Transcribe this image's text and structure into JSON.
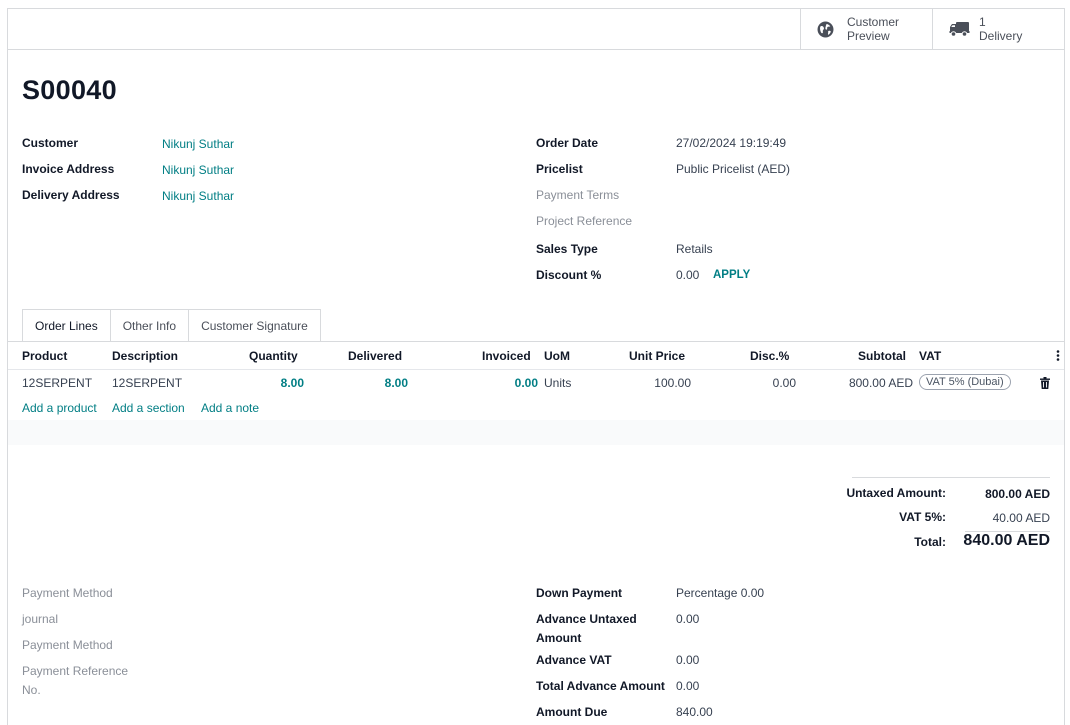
{
  "smart_buttons": {
    "preview": {
      "line1": "Customer",
      "line2": "Preview",
      "icon": "globe-icon"
    },
    "delivery": {
      "count": "1",
      "label": "Delivery",
      "icon": "truck-icon"
    }
  },
  "record": {
    "name": "S00040"
  },
  "left_fields": {
    "customer": {
      "label": "Customer",
      "value": "Nikunj Suthar"
    },
    "invoice_address": {
      "label": "Invoice Address",
      "value": "Nikunj Suthar"
    },
    "delivery_address": {
      "label": "Delivery Address",
      "value": "Nikunj Suthar"
    }
  },
  "right_fields": {
    "order_date": {
      "label": "Order Date",
      "value": "27/02/2024 19:19:49"
    },
    "pricelist": {
      "label": "Pricelist",
      "value": "Public Pricelist (AED)"
    },
    "payment_terms": {
      "label": "Payment Terms",
      "value": ""
    },
    "project_reference": {
      "label": "Project Reference",
      "value": ""
    },
    "sales_type": {
      "label": "Sales Type",
      "value": "Retails"
    },
    "discount": {
      "label": "Discount %",
      "value": "0.00",
      "apply": "APPLY"
    }
  },
  "tabs": [
    {
      "label": "Order Lines",
      "active": true
    },
    {
      "label": "Other Info",
      "active": false
    },
    {
      "label": "Customer Signature",
      "active": false
    }
  ],
  "columns": {
    "product": "Product",
    "description": "Description",
    "quantity": "Quantity",
    "delivered": "Delivered",
    "invoiced": "Invoiced",
    "uom": "UoM",
    "unit_price": "Unit Price",
    "discount": "Disc.%",
    "subtotal": "Subtotal",
    "vat": "VAT"
  },
  "lines": [
    {
      "product": "12SERPENT",
      "description": "12SERPENT",
      "quantity": "8.00",
      "delivered": "8.00",
      "invoiced": "0.00",
      "uom": "Units",
      "unit_price": "100.00",
      "discount": "0.00",
      "subtotal": "800.00 AED",
      "vat": "VAT 5% (Dubai)"
    }
  ],
  "add_links": {
    "product": "Add a product",
    "section": "Add a section",
    "note": "Add a note"
  },
  "totals": {
    "untaxed": {
      "label": "Untaxed Amount:",
      "value": "800.00 AED"
    },
    "vat": {
      "label": "VAT 5%:",
      "value": "40.00 AED"
    },
    "total": {
      "label": "Total:",
      "value": "840.00 AED"
    }
  },
  "bottom_left": {
    "payment_method": "Payment Method",
    "journal": "journal",
    "payment_method2": "Payment Method",
    "payment_reference_1": "Payment Reference",
    "payment_reference_2": "No."
  },
  "bottom_right": {
    "down_payment": {
      "label": "Down Payment",
      "value": "Percentage 0.00"
    },
    "advance_untaxed": {
      "label1": "Advance Untaxed",
      "label2": "Amount",
      "value": "0.00"
    },
    "advance_vat": {
      "label": "Advance VAT",
      "value": "0.00"
    },
    "total_advance": {
      "label": "Total Advance Amount",
      "value": "0.00"
    },
    "amount_due": {
      "label": "Amount Due",
      "value": "840.00"
    }
  }
}
